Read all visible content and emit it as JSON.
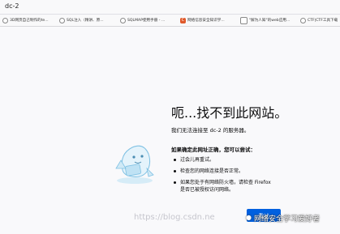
{
  "browser": {
    "url": "dc-2",
    "bookmarks": [
      {
        "label": "3D网页自己制作的te...",
        "icon": "globe-icon"
      },
      {
        "label": "SQL注入（精讲、原...",
        "icon": "globe-icon"
      },
      {
        "label": "SQLMAP使用手册 - ...",
        "icon": "globe-icon"
      },
      {
        "label": "网络信息安全知识学...",
        "icon": "c-icon"
      },
      {
        "label": "\"解为人知\"的web应用...",
        "icon": "box-icon"
      },
      {
        "label": "CTF|CTF工具下载",
        "icon": "globe-icon"
      }
    ]
  },
  "error": {
    "title": "呃...找不到此网站。",
    "subtext": "我们无法连接至 dc-2 的服务器。",
    "check_heading": "如果确定此网址正确，您可以尝试：",
    "tips": [
      "过会儿再重试。",
      "检查您的网络连接是否正常。",
      "如果您处于有网络防火墙，请检查 Firefox 是否已被授权访问网络。"
    ],
    "retry_label": "重试"
  },
  "watermark": {
    "url_text": "https://blog.csdn.ne",
    "brand_text": "网络安全学习爱好者"
  }
}
